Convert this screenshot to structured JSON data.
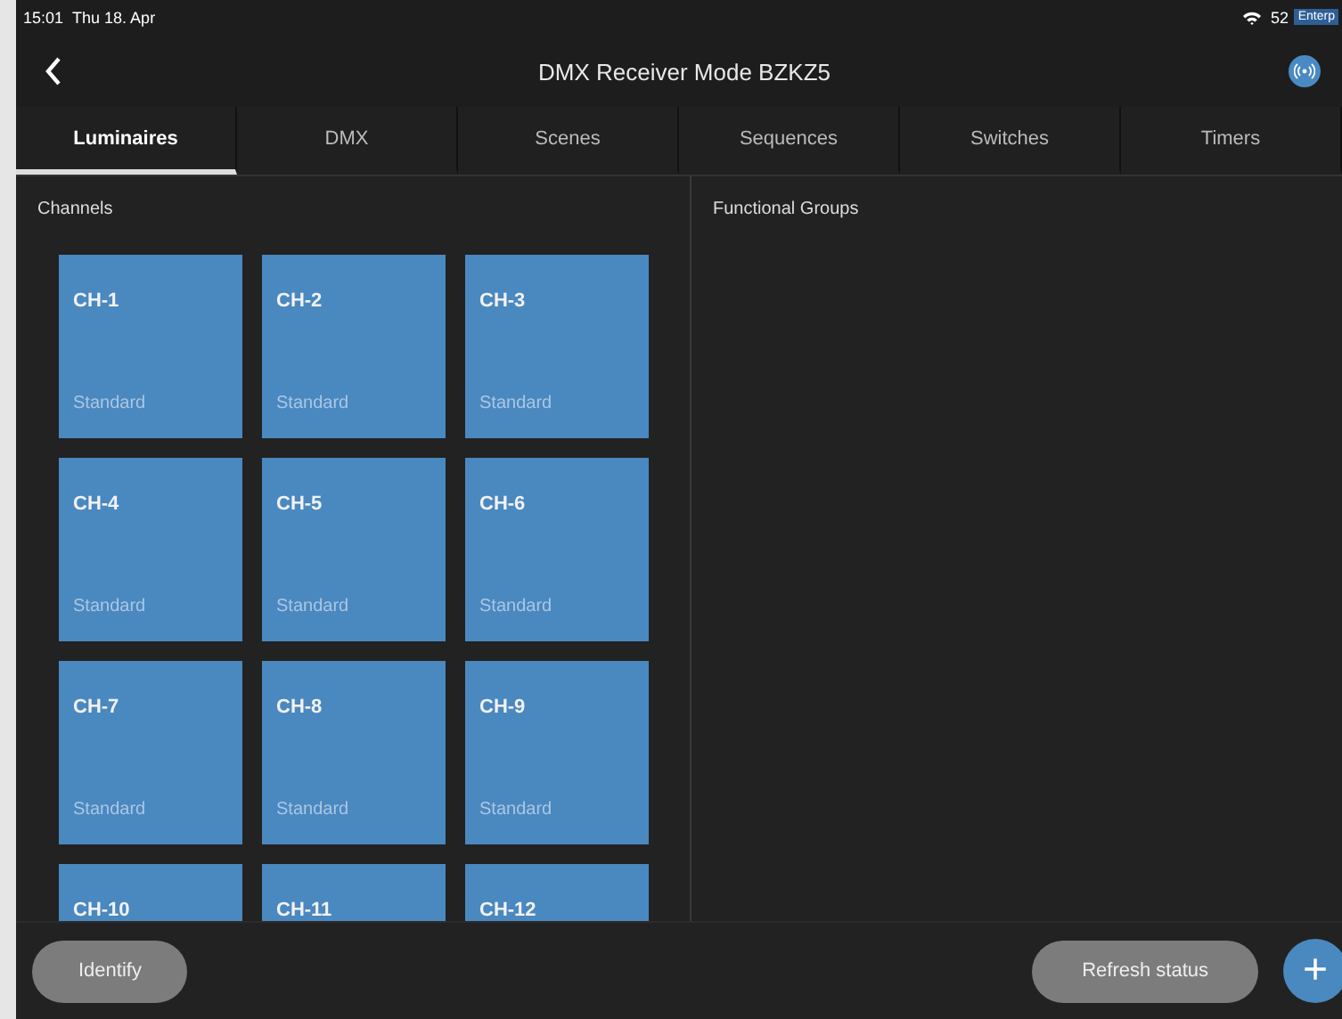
{
  "status_bar": {
    "time": "15:01",
    "date": "Thu 18. Apr",
    "battery": "52",
    "ribbon": "Enterp"
  },
  "nav": {
    "title": "DMX Receiver Mode BZKZ5"
  },
  "tabs": [
    {
      "label": "Luminaires",
      "selected": true
    },
    {
      "label": "DMX",
      "selected": false
    },
    {
      "label": "Scenes",
      "selected": false
    },
    {
      "label": "Sequences",
      "selected": false
    },
    {
      "label": "Switches",
      "selected": false
    },
    {
      "label": "Timers",
      "selected": false
    }
  ],
  "channels": {
    "heading": "Channels",
    "tiles": [
      {
        "name": "CH-1",
        "mode": "Standard"
      },
      {
        "name": "CH-2",
        "mode": "Standard"
      },
      {
        "name": "CH-3",
        "mode": "Standard"
      },
      {
        "name": "CH-4",
        "mode": "Standard"
      },
      {
        "name": "CH-5",
        "mode": "Standard"
      },
      {
        "name": "CH-6",
        "mode": "Standard"
      },
      {
        "name": "CH-7",
        "mode": "Standard"
      },
      {
        "name": "CH-8",
        "mode": "Standard"
      },
      {
        "name": "CH-9",
        "mode": "Standard"
      },
      {
        "name": "CH-10"
      },
      {
        "name": "CH-11"
      },
      {
        "name": "CH-12"
      }
    ]
  },
  "functional_groups": {
    "heading": "Functional Groups"
  },
  "bottom_bar": {
    "identify": "Identify",
    "refresh": "Refresh status",
    "add": "+"
  }
}
